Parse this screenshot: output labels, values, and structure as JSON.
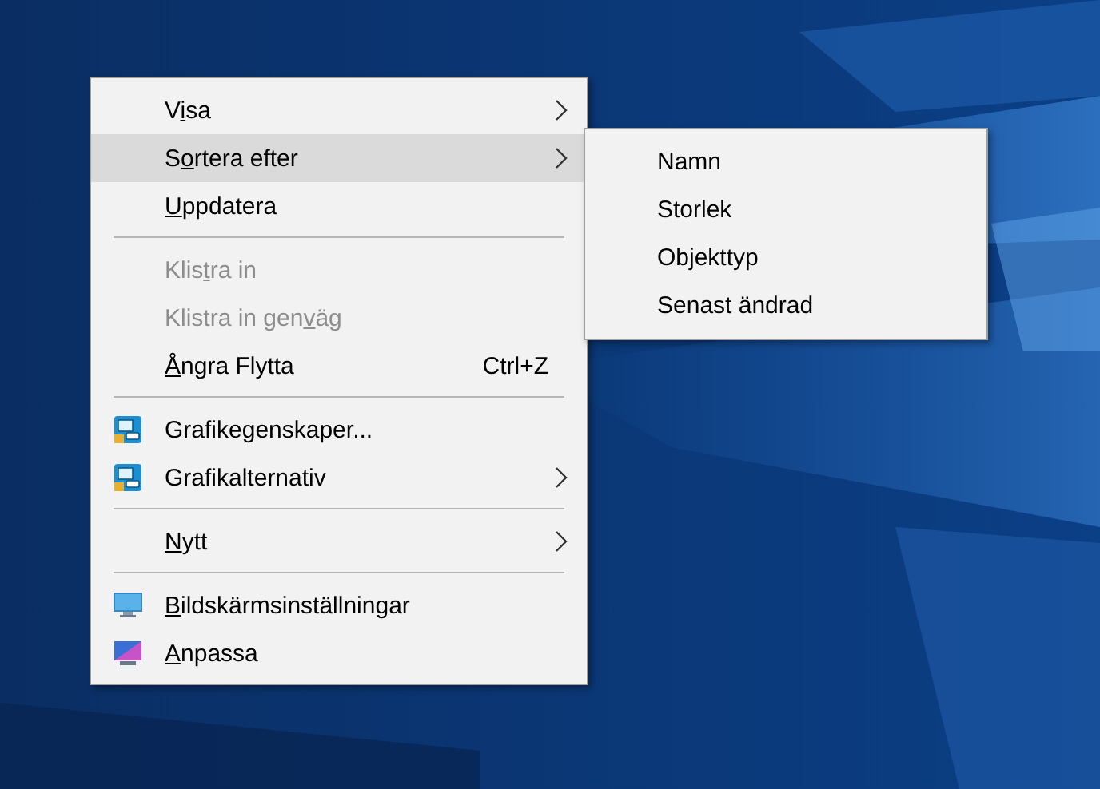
{
  "context_menu": {
    "items": [
      {
        "kind": "item",
        "label": {
          "before": "V",
          "key": "i",
          "after": "sa"
        },
        "submenu": true,
        "selected": false,
        "disabled": false
      },
      {
        "kind": "item",
        "label": {
          "before": "S",
          "key": "o",
          "after": "rtera efter"
        },
        "submenu": true,
        "selected": true,
        "disabled": false
      },
      {
        "kind": "item",
        "label": {
          "key": "U",
          "after": "ppdatera"
        },
        "submenu": false,
        "selected": false,
        "disabled": false
      },
      {
        "kind": "separator"
      },
      {
        "kind": "item",
        "label": {
          "before": "Klis",
          "key": "t",
          "after": "ra in"
        },
        "submenu": false,
        "selected": false,
        "disabled": true
      },
      {
        "kind": "item",
        "label": {
          "before": "Klistra in gen",
          "key": "v",
          "after": "äg"
        },
        "submenu": false,
        "selected": false,
        "disabled": true
      },
      {
        "kind": "item",
        "label": {
          "key": "Å",
          "after": "ngra Flytta"
        },
        "shortcut": "Ctrl+Z",
        "submenu": false,
        "selected": false,
        "disabled": false
      },
      {
        "kind": "separator"
      },
      {
        "kind": "graphics",
        "label": {
          "before": "Grafikegenskaper..."
        },
        "submenu": false,
        "selected": false,
        "disabled": false
      },
      {
        "kind": "graphics",
        "label": {
          "before": "Grafikalternativ"
        },
        "submenu": true,
        "selected": false,
        "disabled": false
      },
      {
        "kind": "separator"
      },
      {
        "kind": "item",
        "label": {
          "key": "N",
          "after": "ytt"
        },
        "submenu": true,
        "selected": false,
        "disabled": false
      },
      {
        "kind": "separator"
      },
      {
        "kind": "display",
        "label": {
          "key": "B",
          "after": "ildskärmsinställningar"
        },
        "submenu": false,
        "selected": false,
        "disabled": false
      },
      {
        "kind": "personalize",
        "label": {
          "key": "A",
          "after": "npassa"
        },
        "submenu": false,
        "selected": false,
        "disabled": false
      }
    ]
  },
  "submenu": {
    "items": [
      {
        "label": "Namn"
      },
      {
        "label": "Storlek"
      },
      {
        "label": "Objekttyp"
      },
      {
        "label": "Senast ändrad"
      }
    ]
  }
}
